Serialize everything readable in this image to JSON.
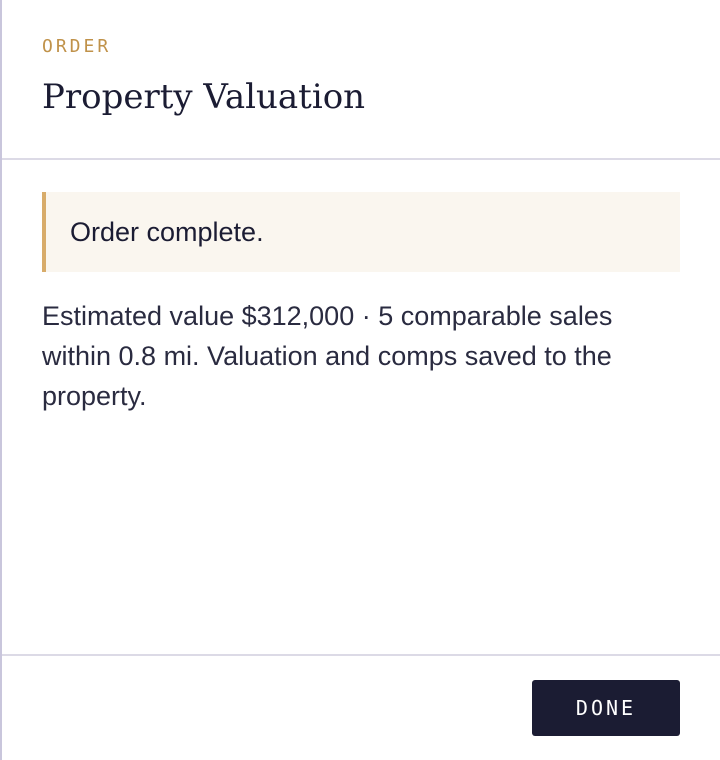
{
  "header": {
    "eyebrow": "ORDER",
    "title": "Property Valuation"
  },
  "notice": {
    "text": "Order complete."
  },
  "summary": {
    "text": "Estimated value $312,000 · 5 comparable sales within 0.8 mi. Valuation and comps saved to the property."
  },
  "footer": {
    "done_label": "DONE"
  },
  "colors": {
    "accent": "#c0924a",
    "notice_border": "#d8ac6a",
    "notice_background": "#faf6ef",
    "primary_button": "#1b1c33",
    "text": "#1b1c33"
  }
}
